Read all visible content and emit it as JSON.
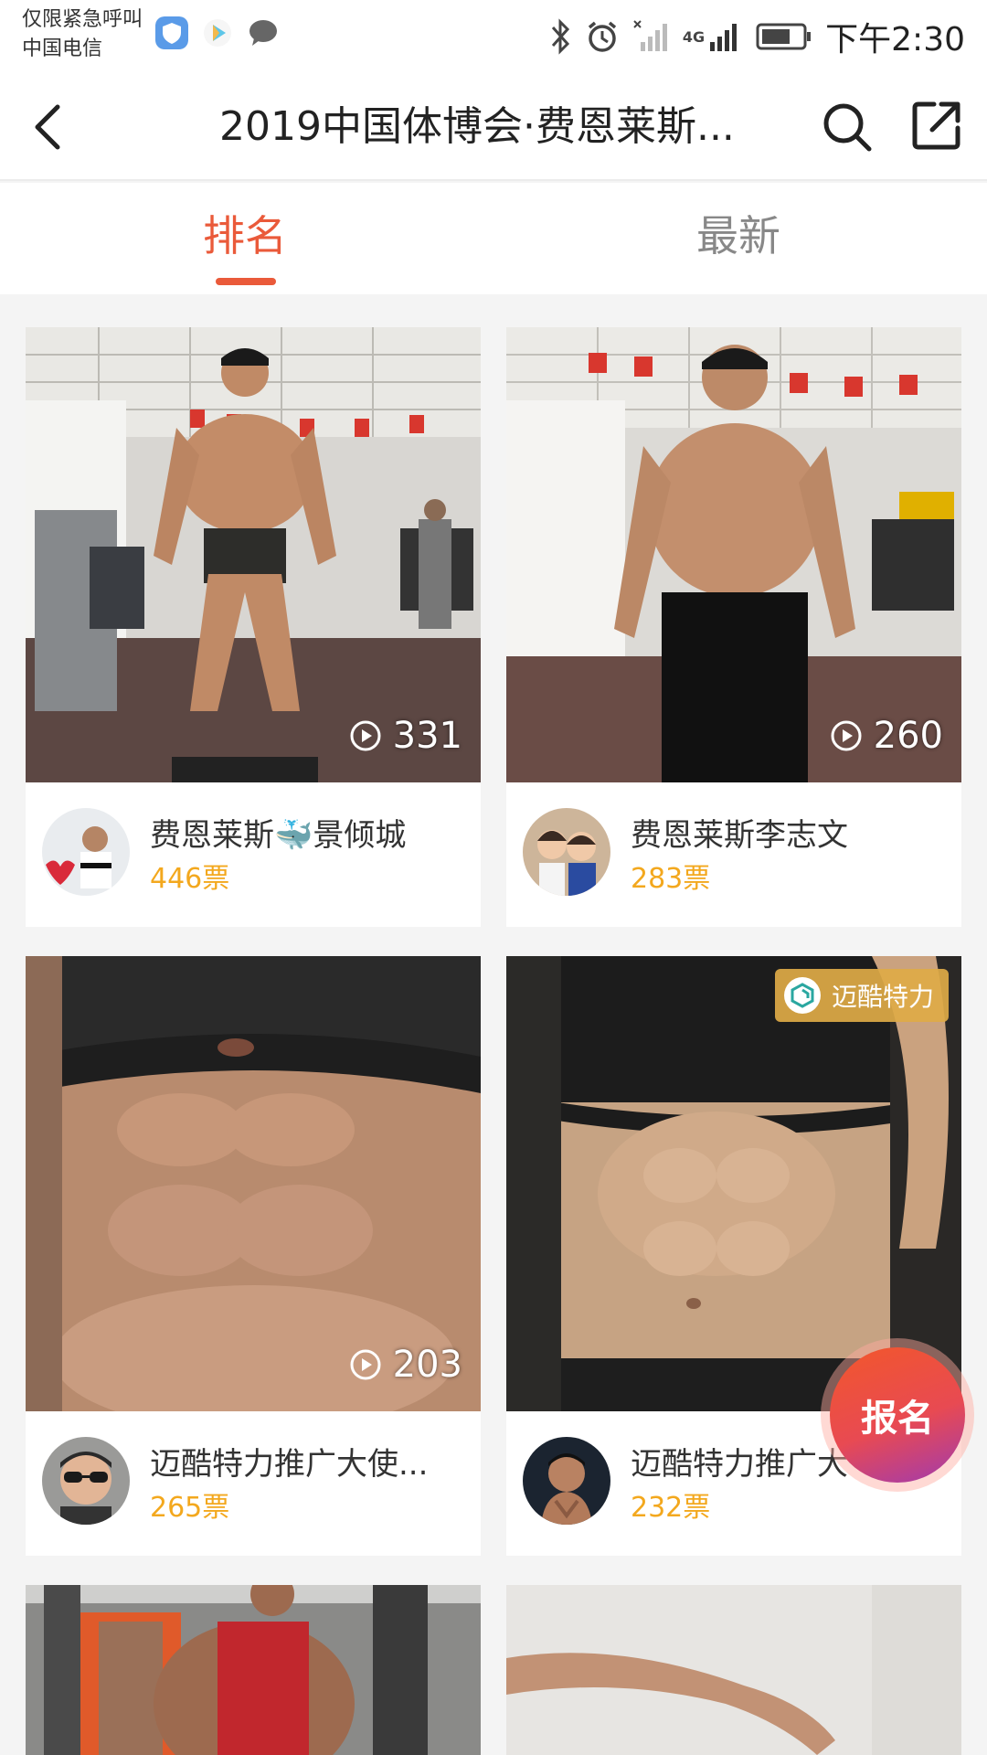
{
  "status_bar": {
    "carrier_line1": "仅限紧急呼叫",
    "carrier_line2": "中国电信",
    "network": "4G",
    "time": "下午2:30"
  },
  "header": {
    "title": "2019中国体博会·费恩莱斯..."
  },
  "tabs": [
    {
      "label": "排名",
      "active": true
    },
    {
      "label": "最新",
      "active": false
    }
  ],
  "cards": [
    {
      "username": "费恩莱斯🐳景倾城",
      "votes": "446票",
      "plays": "331"
    },
    {
      "username": "费恩莱斯李志文",
      "votes": "283票",
      "plays": "260"
    },
    {
      "username": "迈酷特力推广大使...",
      "votes": "265票",
      "plays": "203"
    },
    {
      "username": "迈酷特力推广大",
      "votes": "232票",
      "sponsor": "迈酷特力"
    }
  ],
  "fab": {
    "label": "报名"
  },
  "colors": {
    "accent": "#ea5a3a",
    "votes": "#f3a81e"
  }
}
